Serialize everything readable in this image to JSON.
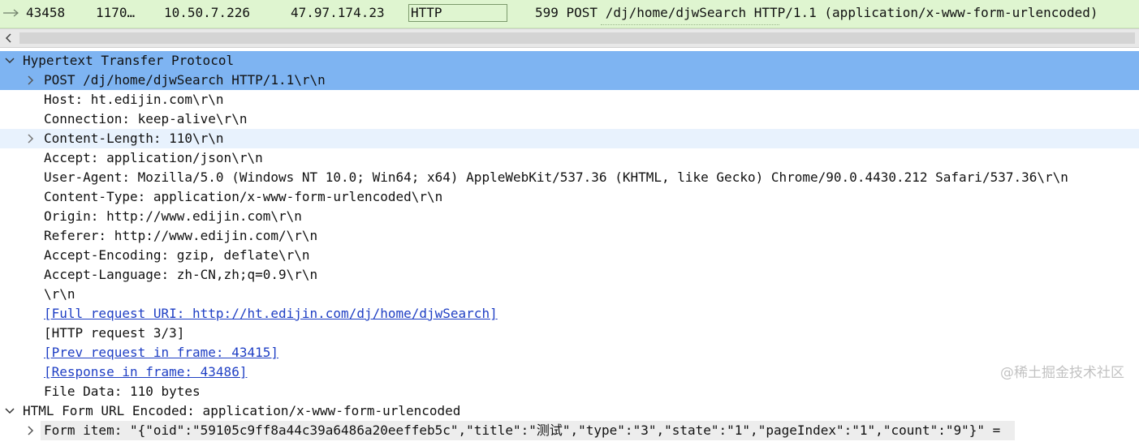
{
  "packet_row": {
    "no": "43458",
    "time": "1170…",
    "source": "10.50.7.226",
    "destination": "47.97.174.23",
    "protocol": "HTTP",
    "info": "599 POST /dj/home/djwSearch HTTP/1.1  (application/x-www-form-urlencoded)"
  },
  "tree": {
    "http_header": "Hypertext Transfer Protocol",
    "request_line": "POST /dj/home/djwSearch HTTP/1.1\\r\\n",
    "host": "Host: ht.edijin.com\\r\\n",
    "connection": "Connection: keep-alive\\r\\n",
    "content_length": "Content-Length: 110\\r\\n",
    "accept": "Accept: application/json\\r\\n",
    "user_agent": "User-Agent: Mozilla/5.0 (Windows NT 10.0; Win64; x64) AppleWebKit/537.36 (KHTML, like Gecko) Chrome/90.0.4430.212 Safari/537.36\\r\\n",
    "content_type": "Content-Type: application/x-www-form-urlencoded\\r\\n",
    "origin": "Origin: http://www.edijin.com\\r\\n",
    "referer": "Referer: http://www.edijin.com/\\r\\n",
    "accept_encoding": "Accept-Encoding: gzip, deflate\\r\\n",
    "accept_language": "Accept-Language: zh-CN,zh;q=0.9\\r\\n",
    "crlf": "\\r\\n",
    "full_uri": "[Full request URI: http://ht.edijin.com/dj/home/djwSearch]",
    "http_request": "[HTTP request 3/3]",
    "prev_request": "[Prev request in frame: 43415]",
    "response_in": "[Response in frame: 43486]",
    "file_data": "File Data: 110 bytes",
    "form_header": "HTML Form URL Encoded: application/x-www-form-urlencoded",
    "form_item": "Form item: \"{\"oid\":\"59105c9ff8a44c39a6486a20eeffeb5c\",\"title\":\"测试\",\"type\":\"3\",\"state\":\"1\",\"pageIndex\":\"1\",\"count\":\"9\"}\" ="
  },
  "watermark": "@稀土掘金技术社区",
  "icons": {
    "row_arrow": "arrow-right-icon",
    "scroll_left": "chevron-left-icon",
    "expanded": "chevron-down-icon",
    "collapsed": "chevron-right-icon"
  },
  "colors": {
    "packet_row_bg": "#dff5d0",
    "selected_bg": "#7eb4f2",
    "hover_bg": "#e8f2fd",
    "link": "#1f3fc4"
  }
}
